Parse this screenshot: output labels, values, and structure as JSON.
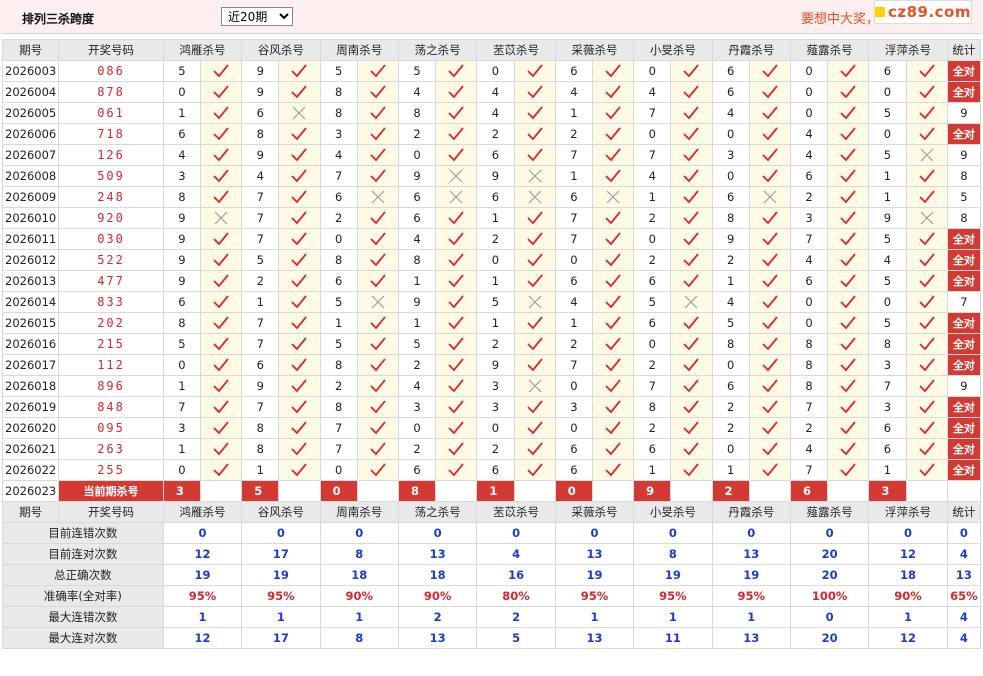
{
  "header": {
    "title": "排列三杀跨度",
    "period_select": "近20期",
    "period_options": [
      "近20期"
    ],
    "slogan": "要想中大奖，",
    "logo_text": "cz89.com"
  },
  "columns": {
    "period": "期号",
    "draw": "开奖号码",
    "experts": [
      "鸿雁杀号",
      "谷风杀号",
      "周南杀号",
      "荡之杀号",
      "苤苡杀号",
      "采薇杀号",
      "小旻杀号",
      "丹霞杀号",
      "薤露杀号",
      "浮萍杀号"
    ],
    "stat": "统计"
  },
  "colors": {
    "check": "#e0262d",
    "cross": "#9a9a9a",
    "all_bg": "#d23a33",
    "blue": "#1b3bd1",
    "red": "#d8262d"
  },
  "rows": [
    {
      "period": "2026003",
      "draw": "086",
      "kills": [
        5,
        9,
        5,
        5,
        0,
        6,
        0,
        6,
        0,
        6
      ],
      "hits": [
        1,
        1,
        1,
        1,
        1,
        1,
        1,
        1,
        1,
        1
      ],
      "stat": "全对"
    },
    {
      "period": "2026004",
      "draw": "878",
      "kills": [
        0,
        9,
        8,
        4,
        4,
        4,
        4,
        6,
        0,
        0
      ],
      "hits": [
        1,
        1,
        1,
        1,
        1,
        1,
        1,
        1,
        1,
        1
      ],
      "stat": "全对"
    },
    {
      "period": "2026005",
      "draw": "061",
      "kills": [
        1,
        6,
        8,
        8,
        4,
        1,
        7,
        4,
        0,
        5
      ],
      "hits": [
        1,
        0,
        1,
        1,
        1,
        1,
        1,
        1,
        1,
        1
      ],
      "stat": "9"
    },
    {
      "period": "2026006",
      "draw": "718",
      "kills": [
        6,
        8,
        3,
        2,
        2,
        2,
        0,
        0,
        4,
        0
      ],
      "hits": [
        1,
        1,
        1,
        1,
        1,
        1,
        1,
        1,
        1,
        1
      ],
      "stat": "全对"
    },
    {
      "period": "2026007",
      "draw": "126",
      "kills": [
        4,
        9,
        4,
        0,
        6,
        7,
        7,
        3,
        4,
        5
      ],
      "hits": [
        1,
        1,
        1,
        1,
        1,
        1,
        1,
        1,
        1,
        0
      ],
      "stat": "9"
    },
    {
      "period": "2026008",
      "draw": "509",
      "kills": [
        3,
        4,
        7,
        9,
        9,
        1,
        4,
        0,
        6,
        1
      ],
      "hits": [
        1,
        1,
        1,
        0,
        0,
        1,
        1,
        1,
        1,
        1
      ],
      "stat": "8"
    },
    {
      "period": "2026009",
      "draw": "248",
      "kills": [
        8,
        7,
        6,
        6,
        6,
        6,
        1,
        6,
        2,
        1
      ],
      "hits": [
        1,
        1,
        0,
        0,
        0,
        0,
        1,
        0,
        1,
        1
      ],
      "stat": "5"
    },
    {
      "period": "2026010",
      "draw": "920",
      "kills": [
        9,
        7,
        2,
        6,
        1,
        7,
        2,
        8,
        3,
        9
      ],
      "hits": [
        0,
        1,
        1,
        1,
        1,
        1,
        1,
        1,
        1,
        0
      ],
      "stat": "8"
    },
    {
      "period": "2026011",
      "draw": "030",
      "kills": [
        9,
        7,
        0,
        4,
        2,
        7,
        0,
        9,
        7,
        5
      ],
      "hits": [
        1,
        1,
        1,
        1,
        1,
        1,
        1,
        1,
        1,
        1
      ],
      "stat": "全对"
    },
    {
      "period": "2026012",
      "draw": "522",
      "kills": [
        9,
        5,
        8,
        8,
        0,
        0,
        2,
        2,
        4,
        4
      ],
      "hits": [
        1,
        1,
        1,
        1,
        1,
        1,
        1,
        1,
        1,
        1
      ],
      "stat": "全对"
    },
    {
      "period": "2026013",
      "draw": "477",
      "kills": [
        9,
        2,
        6,
        1,
        1,
        6,
        6,
        1,
        6,
        5
      ],
      "hits": [
        1,
        1,
        1,
        1,
        1,
        1,
        1,
        1,
        1,
        1
      ],
      "stat": "全对"
    },
    {
      "period": "2026014",
      "draw": "833",
      "kills": [
        6,
        1,
        5,
        9,
        5,
        4,
        5,
        4,
        0,
        0
      ],
      "hits": [
        1,
        1,
        0,
        1,
        0,
        1,
        0,
        1,
        1,
        1
      ],
      "stat": "7"
    },
    {
      "period": "2026015",
      "draw": "202",
      "kills": [
        8,
        7,
        1,
        1,
        1,
        1,
        6,
        5,
        0,
        5
      ],
      "hits": [
        1,
        1,
        1,
        1,
        1,
        1,
        1,
        1,
        1,
        1
      ],
      "stat": "全对"
    },
    {
      "period": "2026016",
      "draw": "215",
      "kills": [
        5,
        7,
        5,
        5,
        2,
        2,
        0,
        8,
        8,
        8
      ],
      "hits": [
        1,
        1,
        1,
        1,
        1,
        1,
        1,
        1,
        1,
        1
      ],
      "stat": "全对"
    },
    {
      "period": "2026017",
      "draw": "112",
      "kills": [
        0,
        6,
        8,
        2,
        9,
        7,
        2,
        0,
        8,
        3
      ],
      "hits": [
        1,
        1,
        1,
        1,
        1,
        1,
        1,
        1,
        1,
        1
      ],
      "stat": "全对"
    },
    {
      "period": "2026018",
      "draw": "896",
      "kills": [
        1,
        9,
        2,
        4,
        3,
        0,
        7,
        6,
        8,
        7
      ],
      "hits": [
        1,
        1,
        1,
        1,
        0,
        1,
        1,
        1,
        1,
        1
      ],
      "stat": "9"
    },
    {
      "period": "2026019",
      "draw": "848",
      "kills": [
        7,
        7,
        8,
        3,
        3,
        3,
        8,
        2,
        7,
        3
      ],
      "hits": [
        1,
        1,
        1,
        1,
        1,
        1,
        1,
        1,
        1,
        1
      ],
      "stat": "全对"
    },
    {
      "period": "2026020",
      "draw": "095",
      "kills": [
        3,
        8,
        7,
        0,
        0,
        0,
        2,
        2,
        2,
        6
      ],
      "hits": [
        1,
        1,
        1,
        1,
        1,
        1,
        1,
        1,
        1,
        1
      ],
      "stat": "全对"
    },
    {
      "period": "2026021",
      "draw": "263",
      "kills": [
        1,
        8,
        7,
        2,
        2,
        6,
        6,
        0,
        4,
        6
      ],
      "hits": [
        1,
        1,
        1,
        1,
        1,
        1,
        1,
        1,
        1,
        1
      ],
      "stat": "全对"
    },
    {
      "period": "2026022",
      "draw": "255",
      "kills": [
        0,
        1,
        0,
        6,
        6,
        6,
        1,
        1,
        7,
        1
      ],
      "hits": [
        1,
        1,
        1,
        1,
        1,
        1,
        1,
        1,
        1,
        1
      ],
      "stat": "全对"
    }
  ],
  "current": {
    "period": "2026023",
    "label": "当前期杀号",
    "kills": [
      3,
      5,
      0,
      8,
      1,
      0,
      9,
      2,
      6,
      3
    ]
  },
  "summary": [
    {
      "label": "目前连错次数",
      "values": [
        "0",
        "0",
        "0",
        "0",
        "0",
        "0",
        "0",
        "0",
        "0",
        "0"
      ],
      "stat": "0",
      "color": "blue"
    },
    {
      "label": "目前连对次数",
      "values": [
        "12",
        "17",
        "8",
        "13",
        "4",
        "13",
        "8",
        "13",
        "20",
        "12"
      ],
      "stat": "4",
      "color": "blue"
    },
    {
      "label": "总正确次数",
      "values": [
        "19",
        "19",
        "18",
        "18",
        "16",
        "19",
        "19",
        "19",
        "20",
        "18"
      ],
      "stat": "13",
      "color": "blue"
    },
    {
      "label": "准确率(全对率)",
      "values": [
        "95%",
        "95%",
        "90%",
        "90%",
        "80%",
        "95%",
        "95%",
        "95%",
        "100%",
        "90%"
      ],
      "stat": "65%",
      "color": "red"
    },
    {
      "label": "最大连错次数",
      "values": [
        "1",
        "1",
        "1",
        "2",
        "2",
        "1",
        "1",
        "1",
        "0",
        "1"
      ],
      "stat": "4",
      "color": "blue"
    },
    {
      "label": "最大连对次数",
      "values": [
        "12",
        "17",
        "8",
        "13",
        "5",
        "13",
        "11",
        "13",
        "20",
        "12"
      ],
      "stat": "4",
      "color": "blue"
    }
  ]
}
